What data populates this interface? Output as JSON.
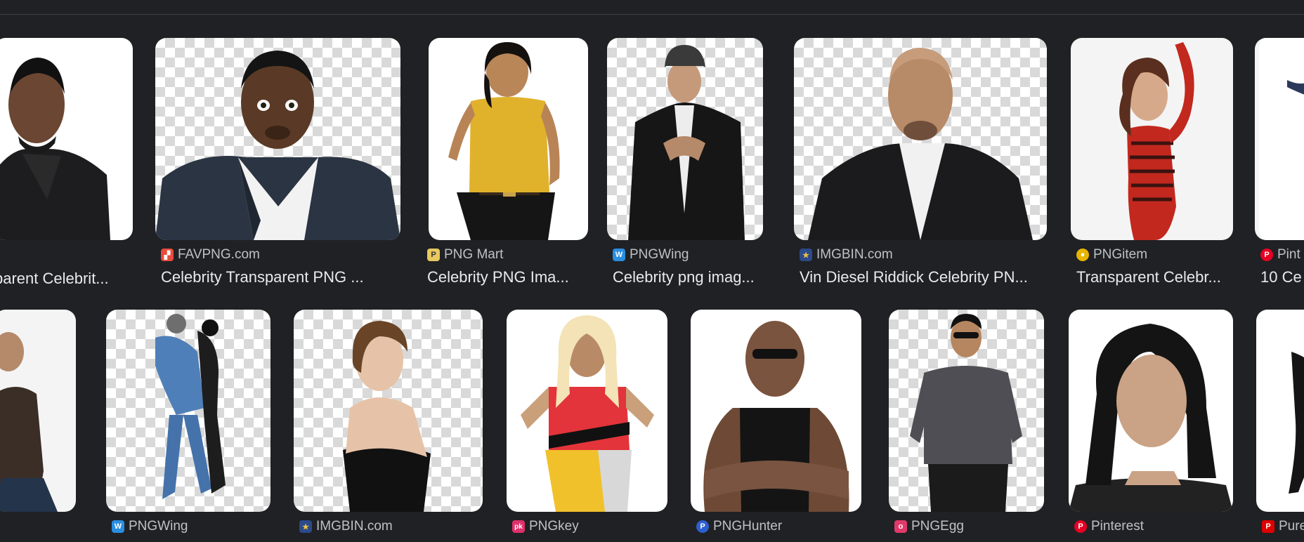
{
  "row1": [
    {
      "source": "",
      "favicon": "none",
      "title": "parent Celebrit..."
    },
    {
      "source": "FAVPNG.com",
      "favicon": "favpng-icon",
      "fav_color": "#e74c3c",
      "title": "Celebrity Transparent PNG ..."
    },
    {
      "source": "PNG Mart",
      "favicon": "pngmart-icon",
      "fav_color": "#e8c860",
      "title": "Celebrity PNG Ima..."
    },
    {
      "source": "PNGWing",
      "favicon": "pngwing-icon",
      "fav_color": "#2a8ee0",
      "title": "Celebrity png imag..."
    },
    {
      "source": "IMGBIN.com",
      "favicon": "imgbin-icon",
      "fav_color": "#2b4a8a",
      "title": "Vin Diesel Riddick Celebrity PN..."
    },
    {
      "source": "PNGitem",
      "favicon": "pngitem-icon",
      "fav_color": "#e8b400",
      "title": "Transparent Celebr..."
    },
    {
      "source": "Pint",
      "favicon": "pinterest-icon",
      "fav_color": "#e60023",
      "title": "10 Ce"
    }
  ],
  "row2": [
    {
      "source": "",
      "favicon": "none"
    },
    {
      "source": "PNGWing",
      "favicon": "pngwing-icon",
      "fav_color": "#2a8ee0"
    },
    {
      "source": "IMGBIN.com",
      "favicon": "imgbin-icon",
      "fav_color": "#2b4a8a"
    },
    {
      "source": "PNGkey",
      "favicon": "pngkey-icon",
      "fav_color": "#e0306a"
    },
    {
      "source": "PNGHunter",
      "favicon": "pnghunter-icon",
      "fav_color": "#2c5fd0"
    },
    {
      "source": "PNGEgg",
      "favicon": "pngegg-icon",
      "fav_color": "#e03a6a"
    },
    {
      "source": "Pinterest",
      "favicon": "pinterest-icon",
      "fav_color": "#e60023"
    },
    {
      "source": "Pure",
      "favicon": "pure-icon",
      "fav_color": "#e00000"
    }
  ],
  "fav_glyphs": {
    "favpng-icon": "▞",
    "pngmart-icon": "P",
    "pngwing-icon": "W",
    "imgbin-icon": "★",
    "pngitem-icon": "●",
    "pinterest-icon": "P",
    "pngkey-icon": "pk",
    "pnghunter-icon": "P",
    "pngegg-icon": "o",
    "pure-icon": "P"
  }
}
